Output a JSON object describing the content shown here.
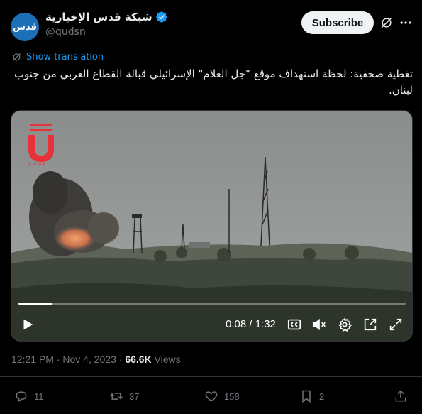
{
  "author": {
    "avatar_text": "قدس",
    "display_name": "شبكة قدس الإخبارية",
    "handle": "@qudsn"
  },
  "header": {
    "subscribe_label": "Subscribe"
  },
  "translation": {
    "label": "Show translation"
  },
  "tweet": {
    "text": "تغطية صحفية: لحظة استهداف موقع \"جل العلام\" الإسرائيلي قبالة القطاع الغربي من جنوب لبنان."
  },
  "video": {
    "watermark_text": "قناة المنار",
    "time": "0:08 / 1:32",
    "progress": 0.087
  },
  "meta": {
    "timestamp": "12:21 PM · Nov 4, 2023 · ",
    "views_count": "66.6K",
    "views_label": " Views"
  },
  "actions": {
    "replies": "11",
    "reposts": "37",
    "likes": "158",
    "bookmarks": "2"
  },
  "colors": {
    "accent": "#1d9bf0",
    "muted": "#71767b",
    "background": "#000000"
  }
}
